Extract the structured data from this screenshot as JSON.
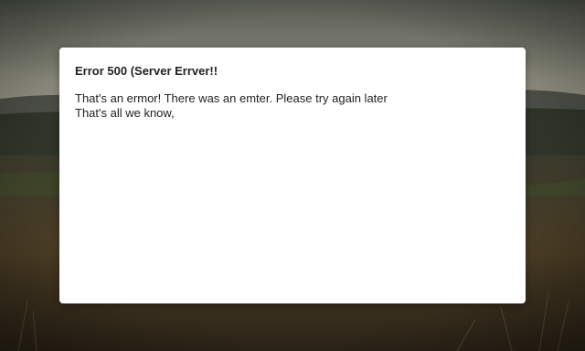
{
  "dialog": {
    "title": "Error 500 (Server Errver!!",
    "line1": "That's an ermor! There was an emter. Please try again later",
    "line2": "That's all we know,"
  },
  "colors": {
    "dialog_bg": "#ffffff",
    "text": "#222222",
    "sky_top": "#5c5f55",
    "sky_bottom": "#8a8a7a",
    "field": "#3b3422"
  }
}
